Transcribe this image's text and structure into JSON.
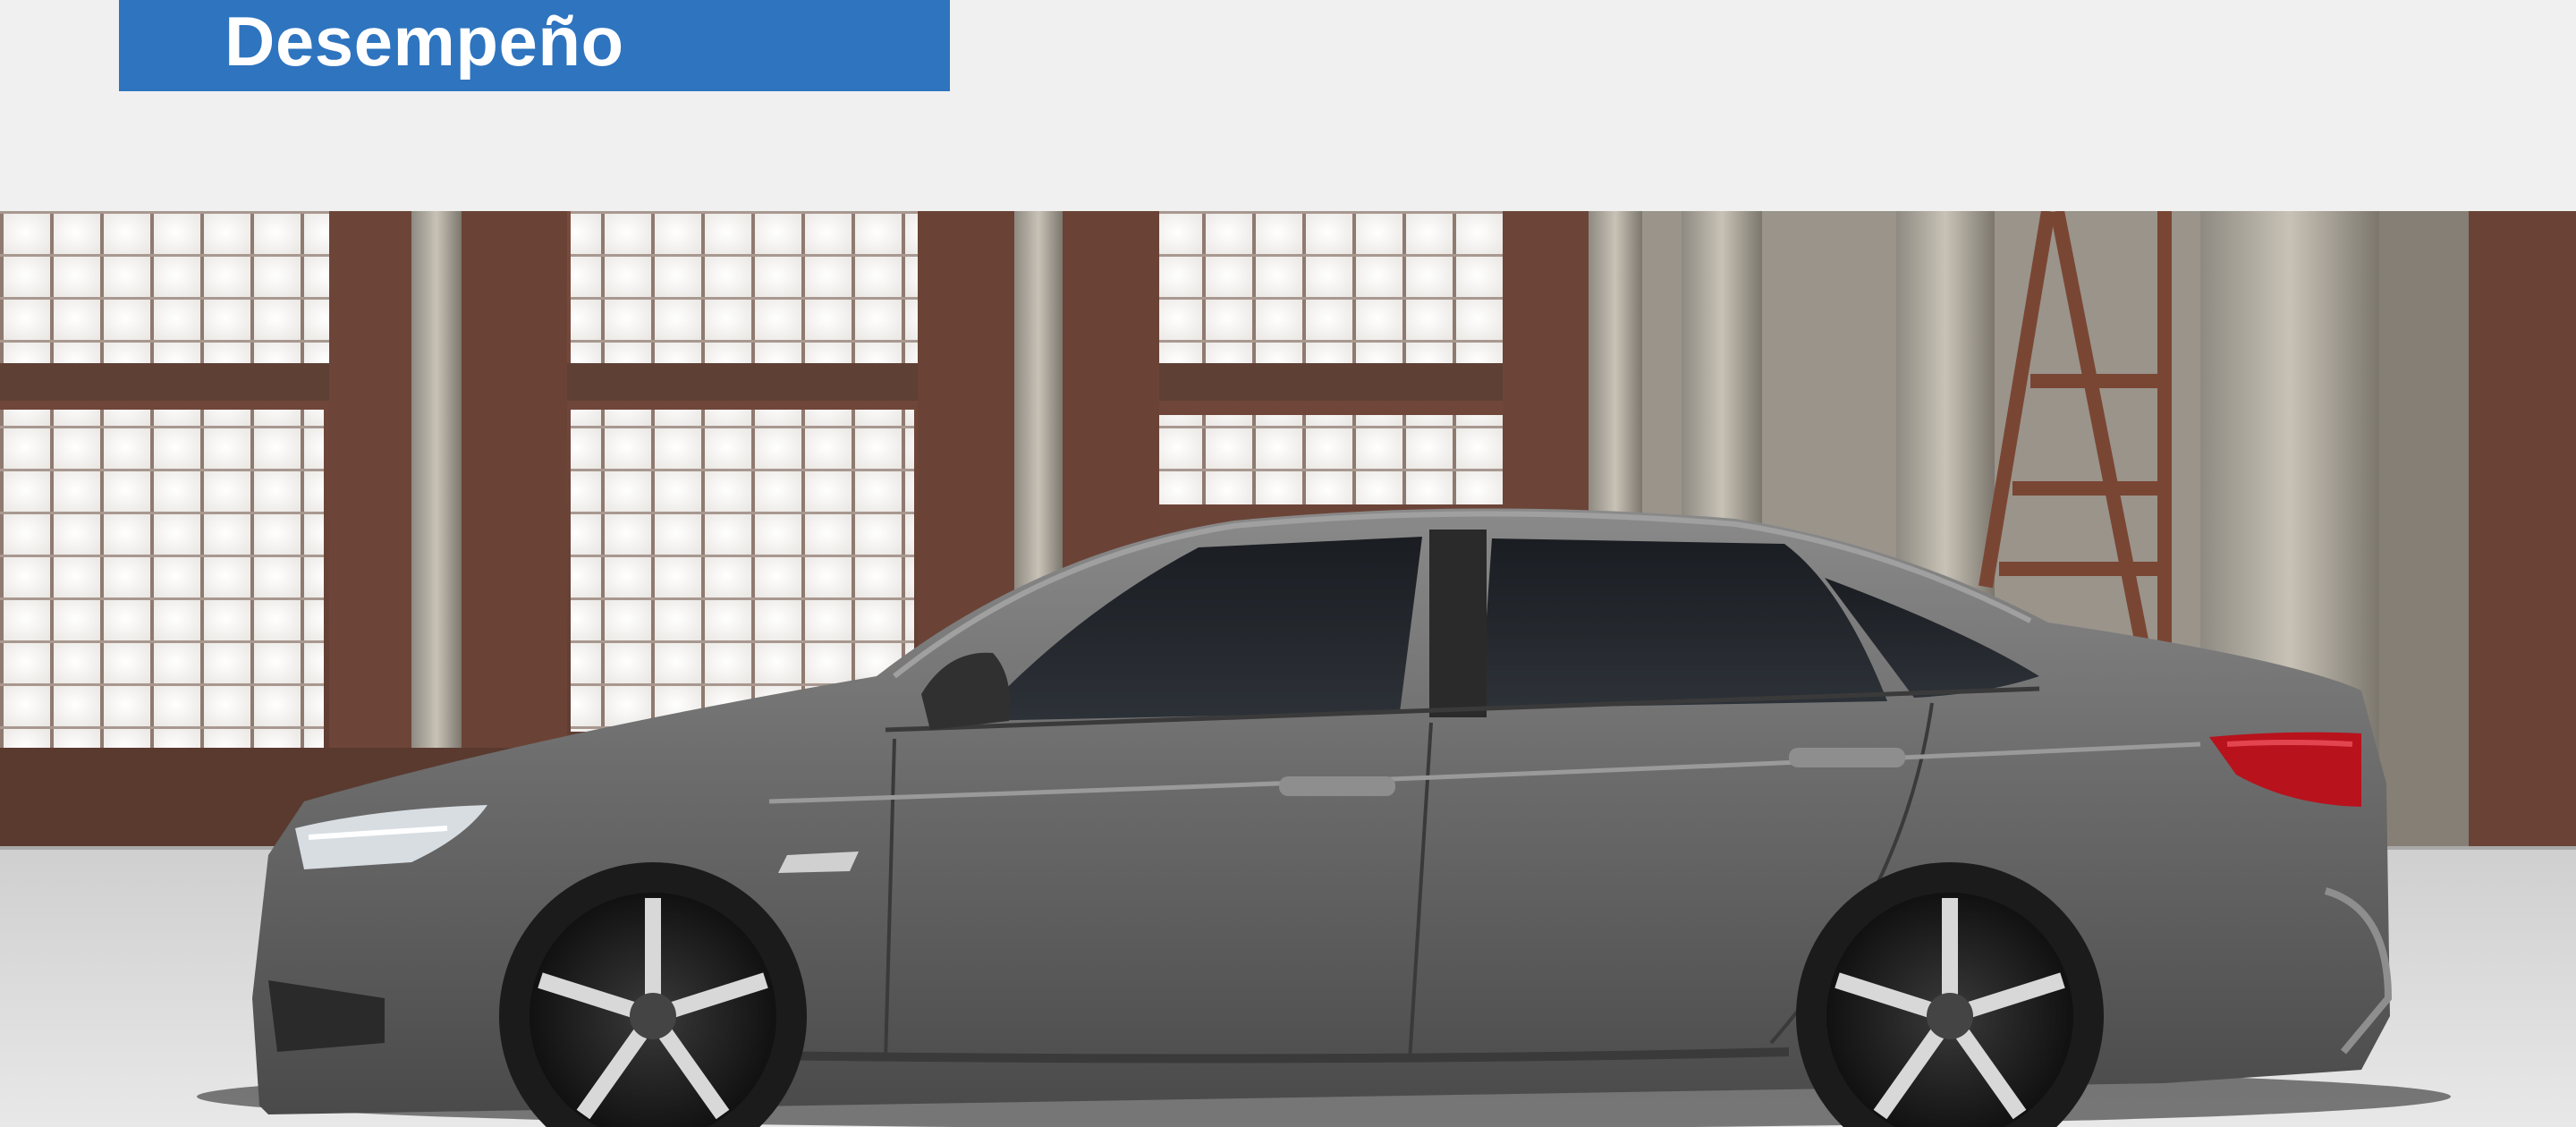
{
  "header": {
    "title": "Desempeño",
    "title_bg_color": "#2e74bf",
    "title_text_color": "#ffffff"
  },
  "hero": {
    "subject": "car-side-view-in-warehouse",
    "car_color": "#6a6a6a"
  }
}
